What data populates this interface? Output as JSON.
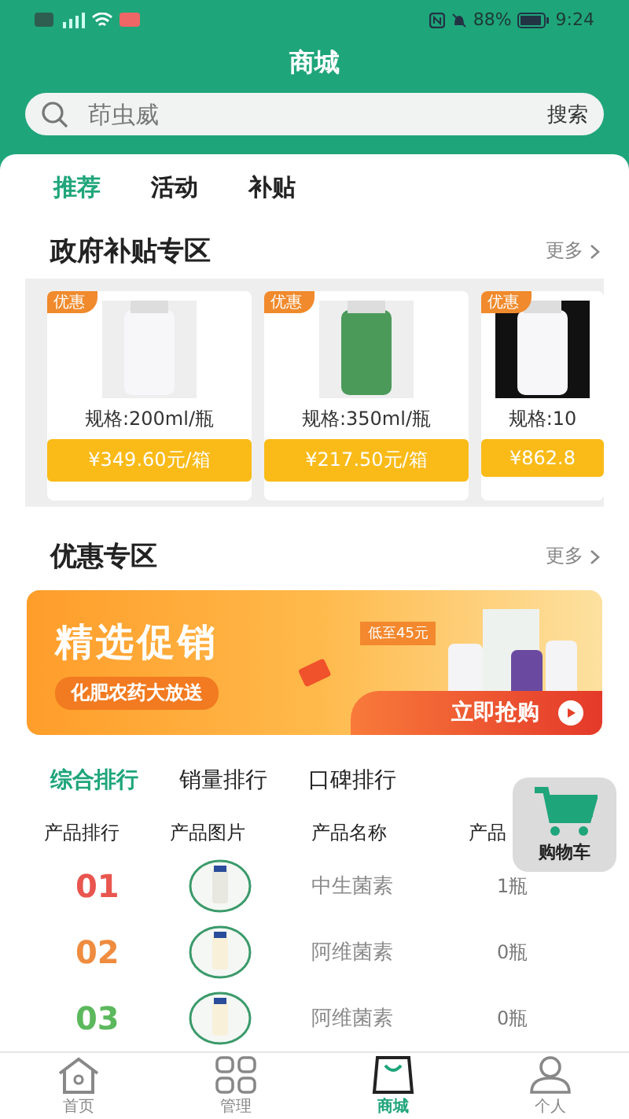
{
  "status_bar": {
    "battery": "88%",
    "time": "9:24"
  },
  "header": {
    "title": "商城"
  },
  "search": {
    "placeholder": "茚虫威",
    "button": "搜索"
  },
  "tabs": [
    {
      "label": "推荐",
      "selected": true
    },
    {
      "label": "活动",
      "selected": false
    },
    {
      "label": "补贴",
      "selected": false
    }
  ],
  "subsidy_section": {
    "title": "政府补贴专区",
    "more": "更多",
    "products": [
      {
        "badge": "优惠",
        "spec": "规格:200ml/瓶",
        "price": "¥349.60元/箱"
      },
      {
        "badge": "优惠",
        "spec": "规格:350ml/瓶",
        "price": "¥217.50元/箱"
      },
      {
        "badge": "优惠",
        "spec": "规格:10",
        "price": "¥862.8"
      }
    ]
  },
  "promo_section": {
    "title": "优惠专区",
    "more": "更多",
    "banner": {
      "headline": "精选促销",
      "subline": "化肥农药大放送",
      "price_tag": "低至45元",
      "action": "立即抢购"
    }
  },
  "ranking_tabs": [
    {
      "label": "综合排行",
      "selected": true
    },
    {
      "label": "销量排行",
      "selected": false
    },
    {
      "label": "口碑排行",
      "selected": false
    }
  ],
  "ranking_table": {
    "columns": [
      "产品排行",
      "产品图片",
      "产品名称",
      "产品"
    ],
    "rows": [
      {
        "rank": "01",
        "color": "#e8564f",
        "name": "中生菌素",
        "sales": "1瓶"
      },
      {
        "rank": "02",
        "color": "#ef8c3f",
        "name": "阿维菌素",
        "sales": "0瓶"
      },
      {
        "rank": "03",
        "color": "#5cb85c",
        "name": "阿维菌素",
        "sales": "0瓶"
      }
    ]
  },
  "cart_button": {
    "label": "购物车"
  },
  "bottom_nav": [
    {
      "kind": "home",
      "label": "首页",
      "selected": false
    },
    {
      "kind": "grid",
      "label": "管理",
      "selected": false
    },
    {
      "kind": "bag",
      "label": "商城",
      "selected": true
    },
    {
      "kind": "person",
      "label": "个人",
      "selected": false
    }
  ]
}
